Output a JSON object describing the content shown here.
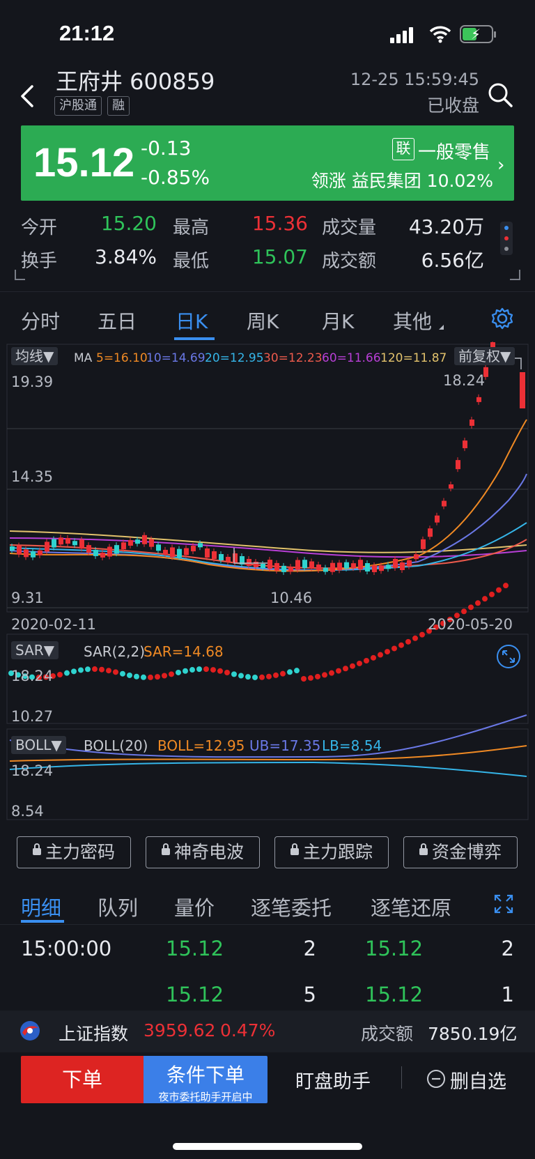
{
  "status_bar": {
    "time": "21:12"
  },
  "header": {
    "name": "王府井 600859",
    "tags": [
      "沪股通",
      "融"
    ],
    "datetime": "12-25 15:59:45",
    "market_status": "已收盘"
  },
  "price_bar": {
    "price": "15.12",
    "change": "-0.13",
    "change_pct": "-0.85%",
    "sector_tag": "联",
    "sector": "一般零售",
    "leader": "领涨 益民集团 10.02%",
    "bg_color": "#2cab53"
  },
  "stats": {
    "open_label": "今开",
    "open": "15.20",
    "high_label": "最高",
    "high": "15.36",
    "volume_label": "成交量",
    "volume": "43.20万",
    "turnover_label": "换手",
    "turnover": "3.84%",
    "low_label": "最低",
    "low": "15.07",
    "amount_label": "成交额",
    "amount": "6.56亿"
  },
  "chart_tabs": [
    "分时",
    "五日",
    "日K",
    "周K",
    "月K",
    "其他"
  ],
  "active_chart_tab": "日K",
  "main_chart": {
    "indicator_button": "均线▼",
    "ma_prefix": "MA",
    "ma": [
      {
        "label": "5=16.10",
        "color": "#f08a24"
      },
      {
        "label": "10=14.69",
        "color": "#6a78e6"
      },
      {
        "label": "20=12.95",
        "color": "#35b5e8"
      },
      {
        "label": "30=12.23",
        "color": "#ec5a4c"
      },
      {
        "label": "60=11.66",
        "color": "#b83fd6"
      },
      {
        "label": "120=11.87",
        "color": "#e2c26c"
      }
    ],
    "adjust_button": "前复权▼",
    "y_top": "19.39",
    "y_mid": "14.35",
    "y_bottom": "9.31",
    "max_label": "18.24",
    "min_label": "10.46",
    "date_start": "2020-02-11",
    "date_end": "2020-05-20"
  },
  "sar_chart": {
    "button": "SAR▼",
    "params": "SAR(2,2)",
    "value": "SAR=14.68",
    "y_top": "18.24",
    "y_bottom": "10.27"
  },
  "boll_chart": {
    "button": "BOLL▼",
    "params": "BOLL(20)",
    "boll": "BOLL=12.95",
    "ub": "UB=17.35",
    "lb": "LB=8.54",
    "y_top": "18.24",
    "y_bottom": "8.54"
  },
  "tools": [
    "主力密码",
    "神奇电波",
    "主力跟踪",
    "资金博弈"
  ],
  "detail_tabs": [
    "明细",
    "队列",
    "量价",
    "逐笔委托",
    "逐笔还原"
  ],
  "trades": [
    {
      "time": "15:00:00",
      "price1": "15.12",
      "vol1": "2",
      "price2": "15.12",
      "vol2": "2"
    },
    {
      "time": "",
      "price1": "15.12",
      "vol1": "5",
      "price2": "15.12",
      "vol2": "1"
    }
  ],
  "index_bar": {
    "name": "上证指数",
    "value": "3959.62",
    "change_pct": "0.47%",
    "amount_label": "成交额",
    "amount": "7850.19亿"
  },
  "bottom_bar": {
    "order": "下单",
    "cond_order": "条件下单",
    "cond_sub": "夜市委托助手开启中",
    "monitor": "盯盘助手",
    "remove": "删自选"
  }
}
